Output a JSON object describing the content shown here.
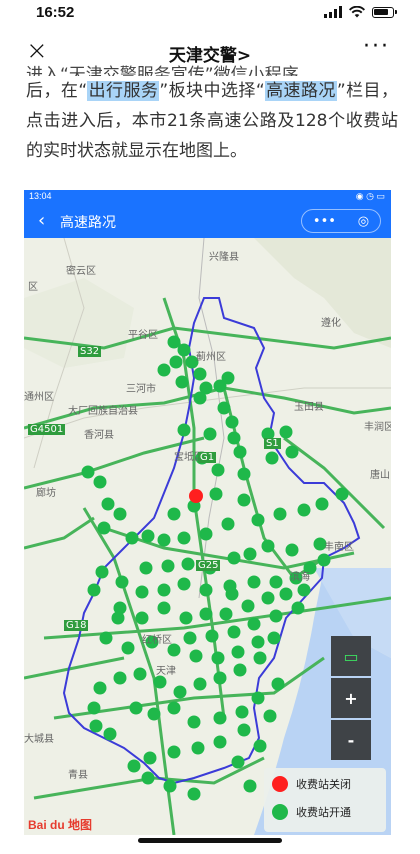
{
  "status": {
    "time": "16:52"
  },
  "nav": {
    "title": "天津交警",
    "chevron": ">",
    "close_icon": "×",
    "more_icon": "···"
  },
  "article": {
    "line0": "进入“天津交警服务宣传”微信小程序",
    "p1_a": "后，在“",
    "p1_hl1": "出行服务",
    "p1_b": "”板块中选择“",
    "p1_hl2": "高速路况",
    "p1_c": "”栏目，点击进入后，本市21条高速公路及128个收费站的实时状态就显示在地图上。"
  },
  "screenshot": {
    "status_time": "13:04",
    "status_icons": "◉ ◷ ▭",
    "title": "高速路况",
    "back_icon": "‹",
    "capsule_more": "•••",
    "capsule_close": "◎",
    "map_labels": [
      {
        "text": "兴隆县"
      },
      {
        "text": "密云区"
      },
      {
        "text": "区"
      },
      {
        "text": "平谷区"
      },
      {
        "text": "遵化"
      },
      {
        "text": "蓟州区"
      },
      {
        "text": "三河市"
      },
      {
        "text": "大厂回族自治县"
      },
      {
        "text": "玉田县"
      },
      {
        "text": "香河县"
      },
      {
        "text": "宝坻区"
      },
      {
        "text": "丰润区"
      },
      {
        "text": "唐山"
      },
      {
        "text": "廊坊"
      },
      {
        "text": "丰南区"
      },
      {
        "text": "滨海"
      },
      {
        "text": "红桥区"
      },
      {
        "text": "天津"
      },
      {
        "text": "大城县"
      },
      {
        "text": "青县"
      },
      {
        "text": "通州区"
      },
      {
        "text": "S32"
      },
      {
        "text": "G1"
      },
      {
        "text": "G4501"
      },
      {
        "text": "G25"
      },
      {
        "text": "G18"
      },
      {
        "text": "S1"
      }
    ],
    "controls": {
      "traffic": "▭",
      "zoom_in": "+",
      "zoom_out": "-"
    },
    "legend": {
      "closed": "收费站关闭",
      "open": "收费站开通",
      "closed_color": "#ff1f1f",
      "open_color": "#1fb84a"
    },
    "baidu_logo": "Bai du 地图"
  }
}
